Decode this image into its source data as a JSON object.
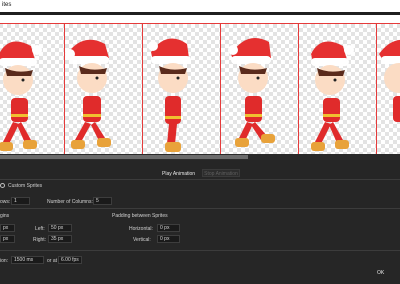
{
  "window": {
    "title": "ites"
  },
  "controls": {
    "play_label": "Play Animation",
    "stop_label": "Stop Animation"
  },
  "layout": {
    "custom_sprites_label": "Custom Sprites",
    "rows_label": "ows:",
    "rows_value": "1",
    "columns_label": "Number of Columns:",
    "columns_value": "5"
  },
  "margins": {
    "header": "gins",
    "left_label": "Left:",
    "left_value": "50 px",
    "right_label": "Right:",
    "right_value": "35 px",
    "partial_top_value": "px",
    "partial_bottom_value": "px"
  },
  "padding": {
    "header": "Padding between Sprites",
    "horizontal_label": "Horizontal:",
    "horizontal_value": "0 px",
    "vertical_label": "Vertical:",
    "vertical_value": "0 px"
  },
  "timing": {
    "duration_label": "ion:",
    "duration_value": "1500 ms",
    "or_at_label": "or at",
    "fps_value": "6.00 fps"
  },
  "footer": {
    "ok_label": "OK"
  },
  "colors": {
    "frame_border": "#e53b3b",
    "hat": "#e53030",
    "suit": "#e02b2b",
    "boots": "#e8a23a"
  }
}
